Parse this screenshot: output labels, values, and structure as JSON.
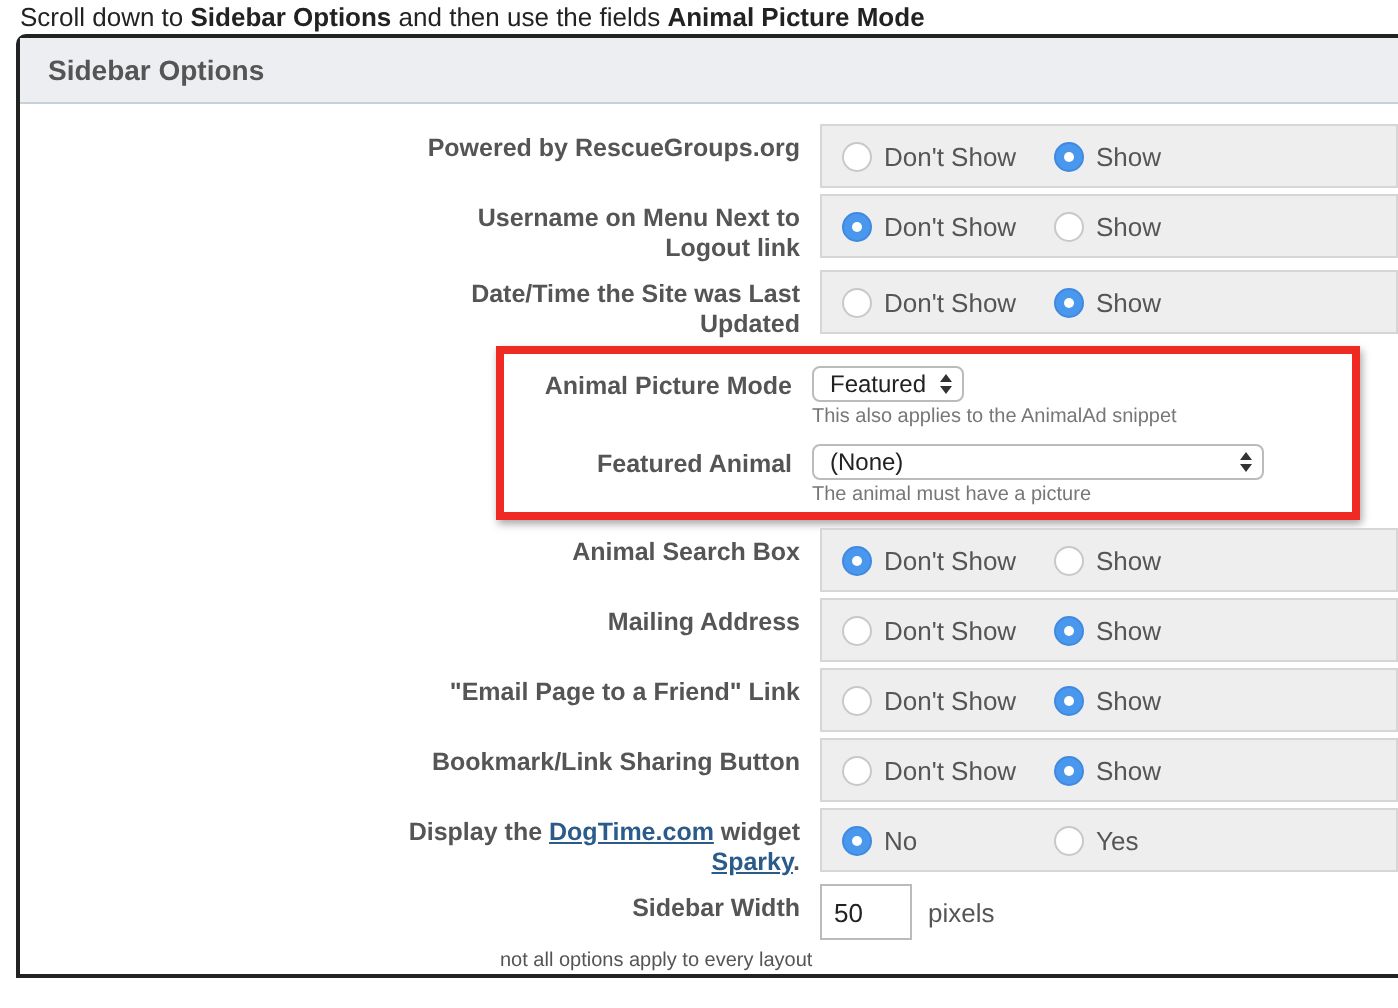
{
  "instruction": "Scroll down to **Sidebar Options** and then use the fields **Animal Picture Mode**",
  "panel": {
    "title": "Sidebar Options"
  },
  "rows": [
    {
      "kind": "radio",
      "label": [
        {
          "text": "Powered by RescueGroups.org"
        }
      ],
      "options": [
        {
          "label": "Don't Show",
          "selected": false
        },
        {
          "label": "Show",
          "selected": true
        }
      ]
    },
    {
      "kind": "radio",
      "label": [
        {
          "text": "Username on Menu Next to Logout link"
        }
      ],
      "options": [
        {
          "label": "Don't Show",
          "selected": true
        },
        {
          "label": "Show",
          "selected": false
        }
      ]
    },
    {
      "kind": "radio",
      "label": [
        {
          "text": "Date/Time the Site was Last Updated"
        }
      ],
      "options": [
        {
          "label": "Don't Show",
          "selected": false
        },
        {
          "label": "Show",
          "selected": true
        }
      ]
    },
    {
      "kind": "highlight",
      "rows": [
        {
          "kind": "select",
          "label": [
            {
              "text": "Animal Picture Mode"
            }
          ],
          "value": "Featured",
          "hint": "This also applies to the AnimalAd snippet"
        },
        {
          "kind": "wide-select",
          "label": [
            {
              "text": "Featured Animal"
            }
          ],
          "value": "(None)",
          "hint": "The animal must have a picture"
        }
      ]
    },
    {
      "kind": "radio",
      "label": [
        {
          "text": "Animal Search Box"
        }
      ],
      "options": [
        {
          "label": "Don't Show",
          "selected": true
        },
        {
          "label": "Show",
          "selected": false
        }
      ]
    },
    {
      "kind": "radio",
      "label": [
        {
          "text": "Mailing Address"
        }
      ],
      "options": [
        {
          "label": "Don't Show",
          "selected": false
        },
        {
          "label": "Show",
          "selected": true
        }
      ]
    },
    {
      "kind": "radio",
      "label": [
        {
          "text": "\"Email Page to a Friend\" Link"
        }
      ],
      "options": [
        {
          "label": "Don't Show",
          "selected": false
        },
        {
          "label": "Show",
          "selected": true
        }
      ]
    },
    {
      "kind": "radio",
      "label": [
        {
          "text": "Bookmark/Link Sharing Button"
        }
      ],
      "options": [
        {
          "label": "Don't Show",
          "selected": false
        },
        {
          "label": "Show",
          "selected": true
        }
      ]
    },
    {
      "kind": "radio",
      "label": [
        {
          "text": "Display the "
        },
        {
          "text": "DogTime.com",
          "link": true
        },
        {
          "text": " widget "
        },
        {
          "text": "Sparky",
          "link": true
        },
        {
          "text": "."
        }
      ],
      "options": [
        {
          "label": "No",
          "selected": true
        },
        {
          "label": "Yes",
          "selected": false
        }
      ]
    },
    {
      "kind": "input",
      "label": [
        {
          "text": "Sidebar Width"
        }
      ],
      "value": "50",
      "unit": "pixels"
    }
  ],
  "note": "not all options apply to every layout"
}
